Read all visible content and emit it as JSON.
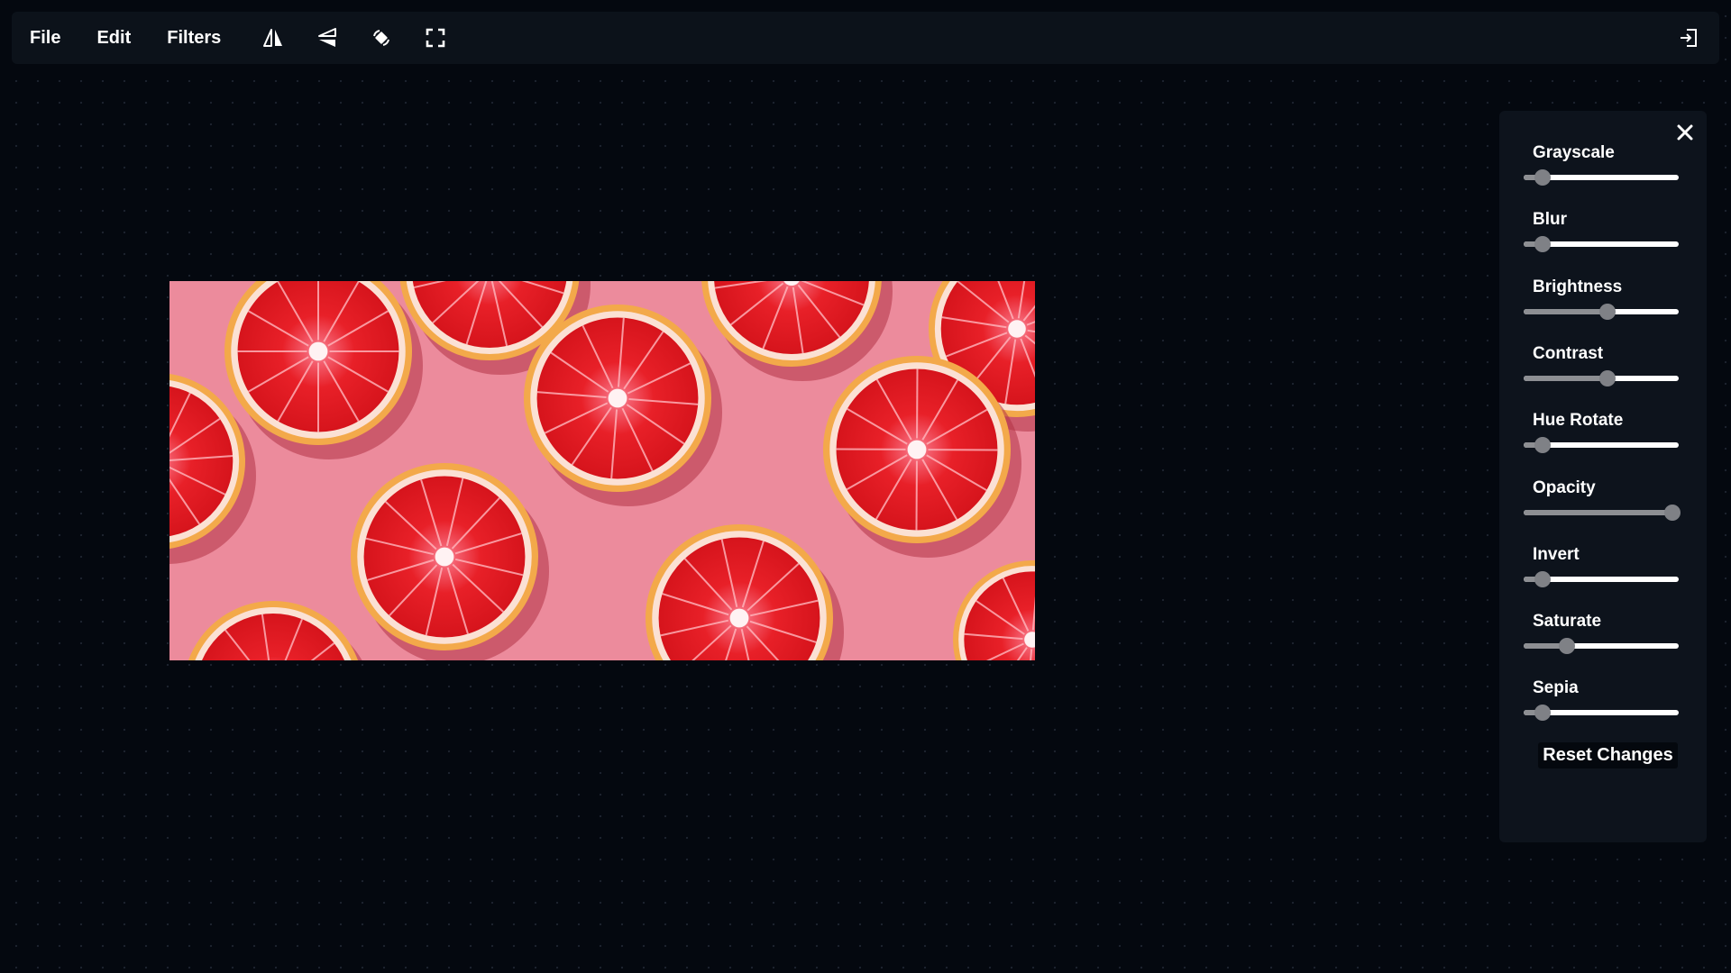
{
  "menu": {
    "file": "File",
    "edit": "Edit",
    "filters": "Filters"
  },
  "toolbar": {
    "icons": [
      "flip-horizontal-icon",
      "flip-vertical-icon",
      "rotate-icon",
      "crop-icon"
    ],
    "exit_icon": "exit-icon"
  },
  "image": {
    "subject": "grapefruit slices on pink background",
    "background_color": "#ec8b9c",
    "fruit_color": "#e8202a"
  },
  "filters_panel": {
    "close_icon": "close-icon",
    "filters": [
      {
        "label": "Grayscale",
        "value": 0.12
      },
      {
        "label": "Blur",
        "value": 0.12
      },
      {
        "label": "Brightness",
        "value": 0.54
      },
      {
        "label": "Contrast",
        "value": 0.54
      },
      {
        "label": "Hue Rotate",
        "value": 0.12
      },
      {
        "label": "Opacity",
        "value": 0.96
      },
      {
        "label": "Invert",
        "value": 0.12
      },
      {
        "label": "Saturate",
        "value": 0.28
      },
      {
        "label": "Sepia",
        "value": 0.12
      }
    ],
    "reset_label": "Reset Changes"
  },
  "colors": {
    "background": "#04080f",
    "toolbar": "#0c121a",
    "panel": "#0d131c",
    "slider_track": "#ffffff",
    "slider_fill": "#8d8f93",
    "slider_thumb": "#7f8186"
  }
}
